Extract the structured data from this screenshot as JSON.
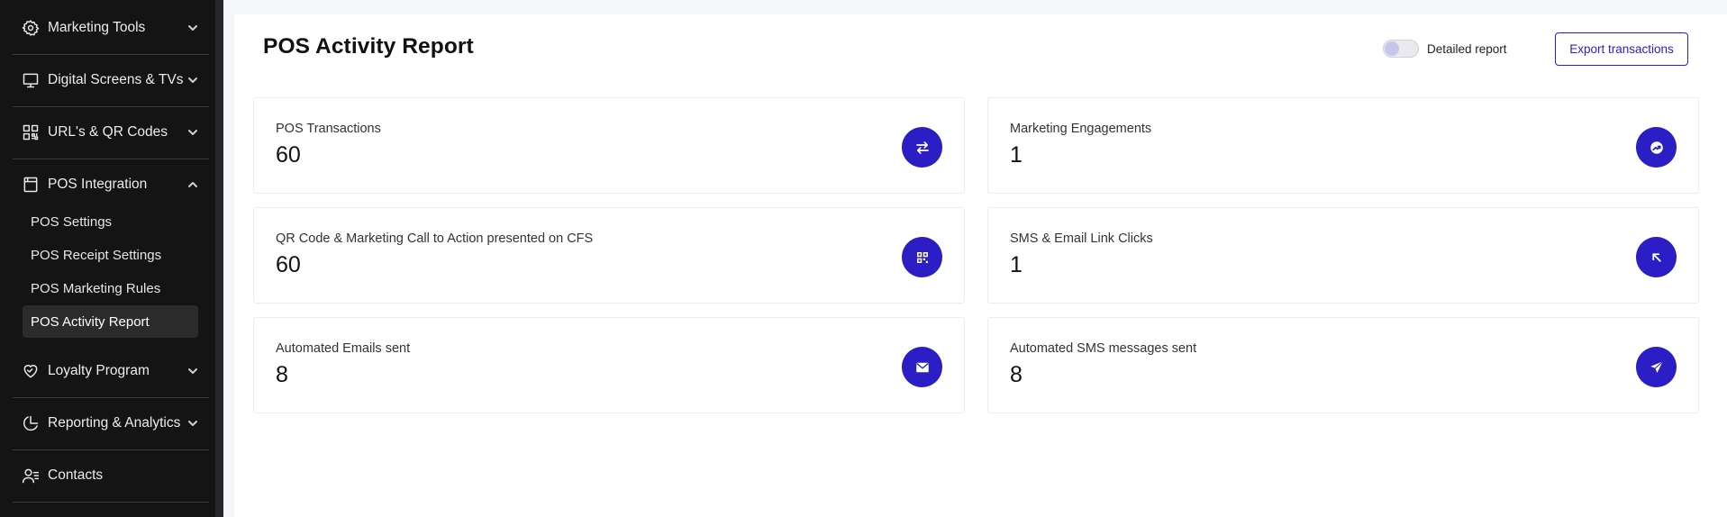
{
  "sidebar": {
    "groups": [
      {
        "label": "Marketing Tools",
        "icon": "gear-icon"
      },
      {
        "label": "Digital Screens & TVs",
        "icon": "monitor-icon"
      },
      {
        "label": "URL's & QR Codes",
        "icon": "qr-code-icon"
      },
      {
        "label": "POS Integration",
        "icon": "register-icon"
      },
      {
        "label": "Loyalty Program",
        "icon": "heart-handshake-icon"
      },
      {
        "label": "Reporting & Analytics",
        "icon": "pie-chart-icon"
      },
      {
        "label": "Contacts",
        "icon": "contacts-icon"
      }
    ],
    "sub_items": [
      {
        "label": "POS Settings"
      },
      {
        "label": "POS Receipt Settings"
      },
      {
        "label": "POS Marketing Rules"
      },
      {
        "label": "POS Activity Report",
        "active": true
      }
    ]
  },
  "main": {
    "title": "POS Activity Report",
    "toggle": {
      "label": "Detailed report",
      "on": false
    },
    "export_label": "Export transactions",
    "cards": [
      {
        "label": "POS Transactions",
        "value": "60",
        "icon": "swap-arrows-icon"
      },
      {
        "label": "Marketing Engagements",
        "value": "1",
        "icon": "trend-up-icon"
      },
      {
        "label": "QR Code & Marketing Call to Action presented on CFS",
        "value": "60",
        "icon": "qr-code-icon"
      },
      {
        "label": "SMS & Email Link Clicks",
        "value": "1",
        "icon": "arrow-up-left-icon"
      },
      {
        "label": "Automated Emails sent",
        "value": "8",
        "icon": "mail-icon"
      },
      {
        "label": "Automated SMS messages sent",
        "value": "8",
        "icon": "send-icon"
      }
    ]
  },
  "colors": {
    "accent": "#2a1ec4",
    "sidebar_bg": "#141414",
    "page_bg": "#f5f6f9"
  }
}
